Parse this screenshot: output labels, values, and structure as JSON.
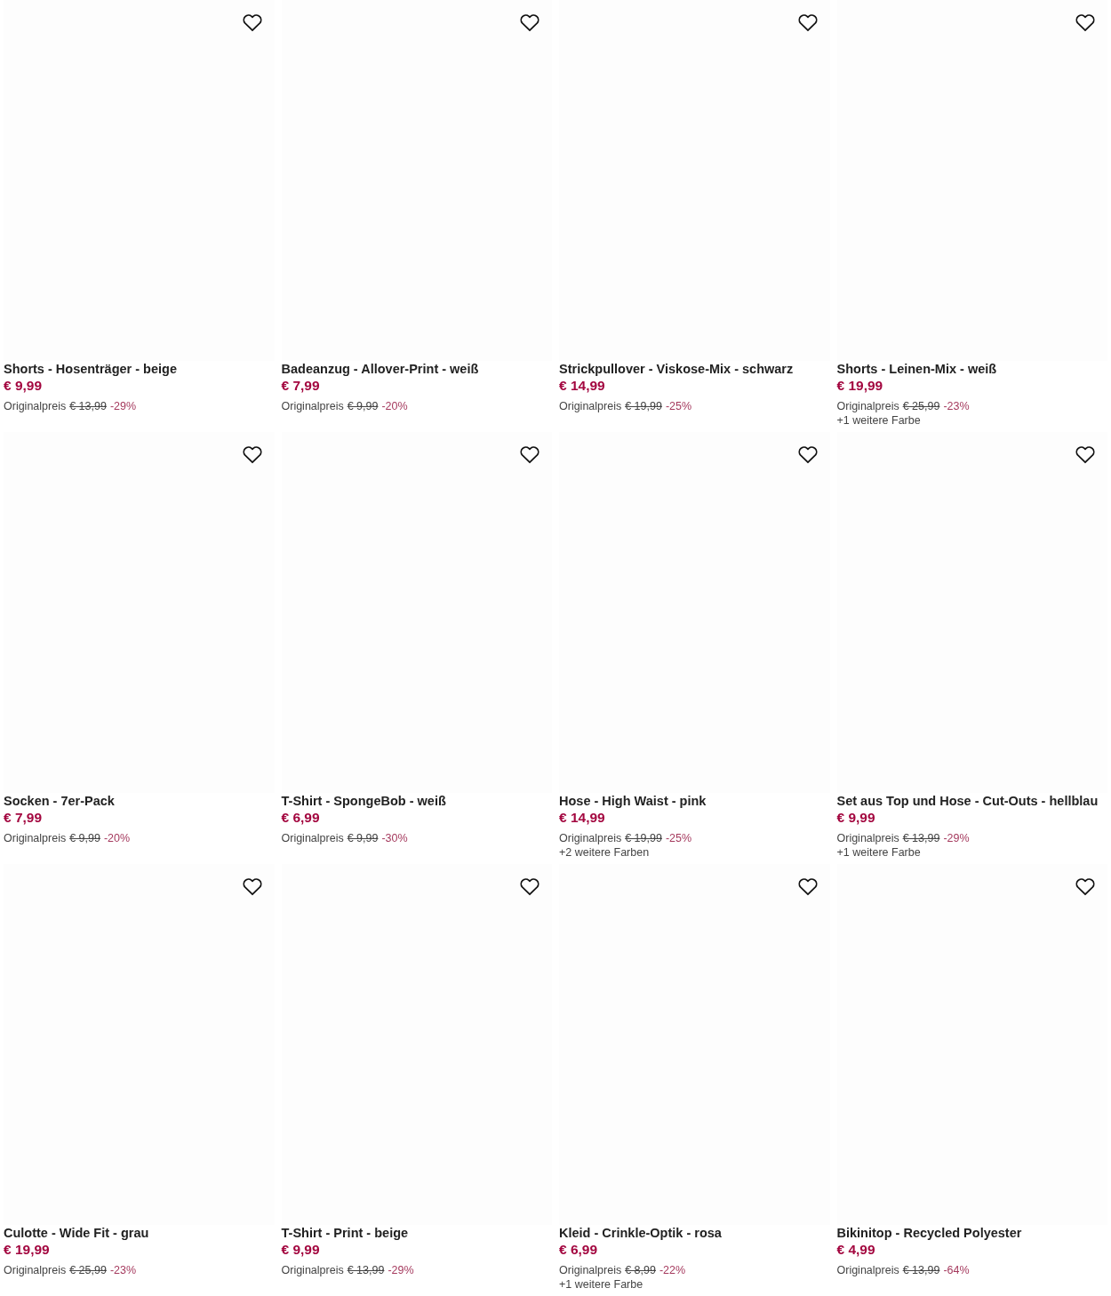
{
  "products": [
    {
      "title": "Shorts - Hosenträger - beige",
      "price": "€ 9,99",
      "original_label": "Originalpreis",
      "original_price": "€ 13,99",
      "discount": "-29%"
    },
    {
      "title": "Badeanzug - Allover-Print - weiß",
      "price": "€ 7,99",
      "original_label": "Originalpreis",
      "original_price": "€ 9,99",
      "discount": "-20%"
    },
    {
      "title": "Strickpullover - Viskose-Mix - schwarz",
      "price": "€ 14,99",
      "original_label": "Originalpreis",
      "original_price": "€ 19,99",
      "discount": "-25%"
    },
    {
      "title": "Shorts - Leinen-Mix - weiß",
      "price": "€ 19,99",
      "original_label": "Originalpreis",
      "original_price": "€ 25,99",
      "discount": "-23%",
      "more_colors": "+1 weitere Farbe"
    },
    {
      "title": "Socken - 7er-Pack",
      "price": "€ 7,99",
      "original_label": "Originalpreis",
      "original_price": "€ 9,99",
      "discount": "-20%"
    },
    {
      "title": "T-Shirt - SpongeBob - weiß",
      "price": "€ 6,99",
      "original_label": "Originalpreis",
      "original_price": "€ 9,99",
      "discount": "-30%"
    },
    {
      "title": "Hose - High Waist - pink",
      "price": "€ 14,99",
      "original_label": "Originalpreis",
      "original_price": "€ 19,99",
      "discount": "-25%",
      "more_colors": "+2 weitere Farben"
    },
    {
      "title": "Set aus Top und Hose - Cut-Outs - hellblau",
      "price": "€ 9,99",
      "original_label": "Originalpreis",
      "original_price": "€ 13,99",
      "discount": "-29%",
      "more_colors": "+1 weitere Farbe"
    },
    {
      "title": "Culotte - Wide Fit - grau",
      "price": "€ 19,99",
      "original_label": "Originalpreis",
      "original_price": "€ 25,99",
      "discount": "-23%"
    },
    {
      "title": "T-Shirt - Print - beige",
      "price": "€ 9,99",
      "original_label": "Originalpreis",
      "original_price": "€ 13,99",
      "discount": "-29%"
    },
    {
      "title": "Kleid - Crinkle-Optik - rosa",
      "price": "€ 6,99",
      "original_label": "Originalpreis",
      "original_price": "€ 8,99",
      "discount": "-22%",
      "more_colors": "+1 weitere Farbe"
    },
    {
      "title": "Bikinitop - Recycled Polyester",
      "price": "€ 4,99",
      "original_label": "Originalpreis",
      "original_price": "€ 13,99",
      "discount": "-64%"
    }
  ]
}
